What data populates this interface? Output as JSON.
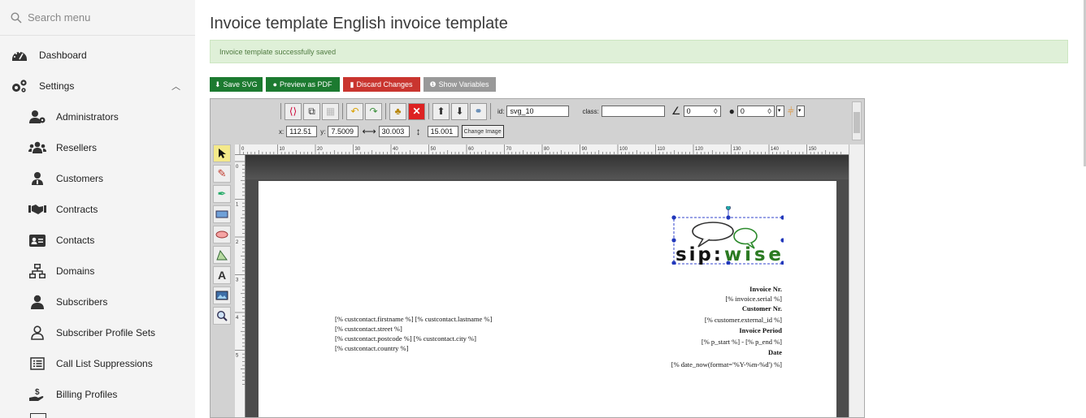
{
  "sidebar": {
    "search_placeholder": "Search menu",
    "items": [
      {
        "label": "Dashboard",
        "icon": "dashboard-icon"
      },
      {
        "label": "Settings",
        "icon": "settings-icon"
      },
      {
        "label": "Administrators",
        "icon": "admin-icon"
      },
      {
        "label": "Resellers",
        "icon": "resellers-icon"
      },
      {
        "label": "Customers",
        "icon": "customers-icon"
      },
      {
        "label": "Contracts",
        "icon": "contracts-icon"
      },
      {
        "label": "Contacts",
        "icon": "contacts-icon"
      },
      {
        "label": "Domains",
        "icon": "domains-icon"
      },
      {
        "label": "Subscribers",
        "icon": "subscribers-icon"
      },
      {
        "label": "Subscriber Profile Sets",
        "icon": "profile-sets-icon"
      },
      {
        "label": "Call List Suppressions",
        "icon": "call-list-icon"
      },
      {
        "label": "Billing Profiles",
        "icon": "billing-icon"
      }
    ]
  },
  "page": {
    "title": "Invoice template English invoice template",
    "alert": "Invoice template successfully saved"
  },
  "actions": {
    "save_svg": "Save SVG",
    "preview_pdf": "Preview as PDF",
    "discard": "Discard Changes",
    "show_vars": "Show Variables"
  },
  "editor": {
    "id_label": "id:",
    "id_value": "svg_10",
    "class_label": "class:",
    "class_value": "",
    "angle_value": "0",
    "blur_value": "0",
    "x_label": "x:",
    "x_value": "112.51",
    "y_label": "y:",
    "y_value": "7.5009",
    "w_value": "30.003",
    "h_value": "15.001",
    "change_image": "Change Image",
    "ruler_h": [
      "0",
      "10",
      "20",
      "30",
      "40",
      "50",
      "60",
      "70",
      "80",
      "90",
      "100",
      "110",
      "120",
      "130",
      "140",
      "150"
    ],
    "ruler_v": [
      "0",
      "1",
      "2",
      "3",
      "4",
      "5"
    ]
  },
  "invoice": {
    "logo_text": "sip:wise",
    "address_lines": [
      "[% custcontact.firstname %] [% custcontact.lastname %]",
      "[% custcontact.street %]",
      "[% custcontact.postcode %] [% custcontact.city %]",
      "[% custcontact.country %]"
    ],
    "invoice_nr_label": "Invoice Nr.",
    "invoice_nr_value": "[% invoice.serial %]",
    "customer_nr_label": "Customer Nr.",
    "customer_nr_value": "[% customer.external_id %]",
    "period_label": "Invoice Period",
    "period_value": "[% p_start %] - [% p_end %]",
    "date_label": "Date",
    "date_value": "[% date_now(format='%Y-%m-%d') %]"
  }
}
